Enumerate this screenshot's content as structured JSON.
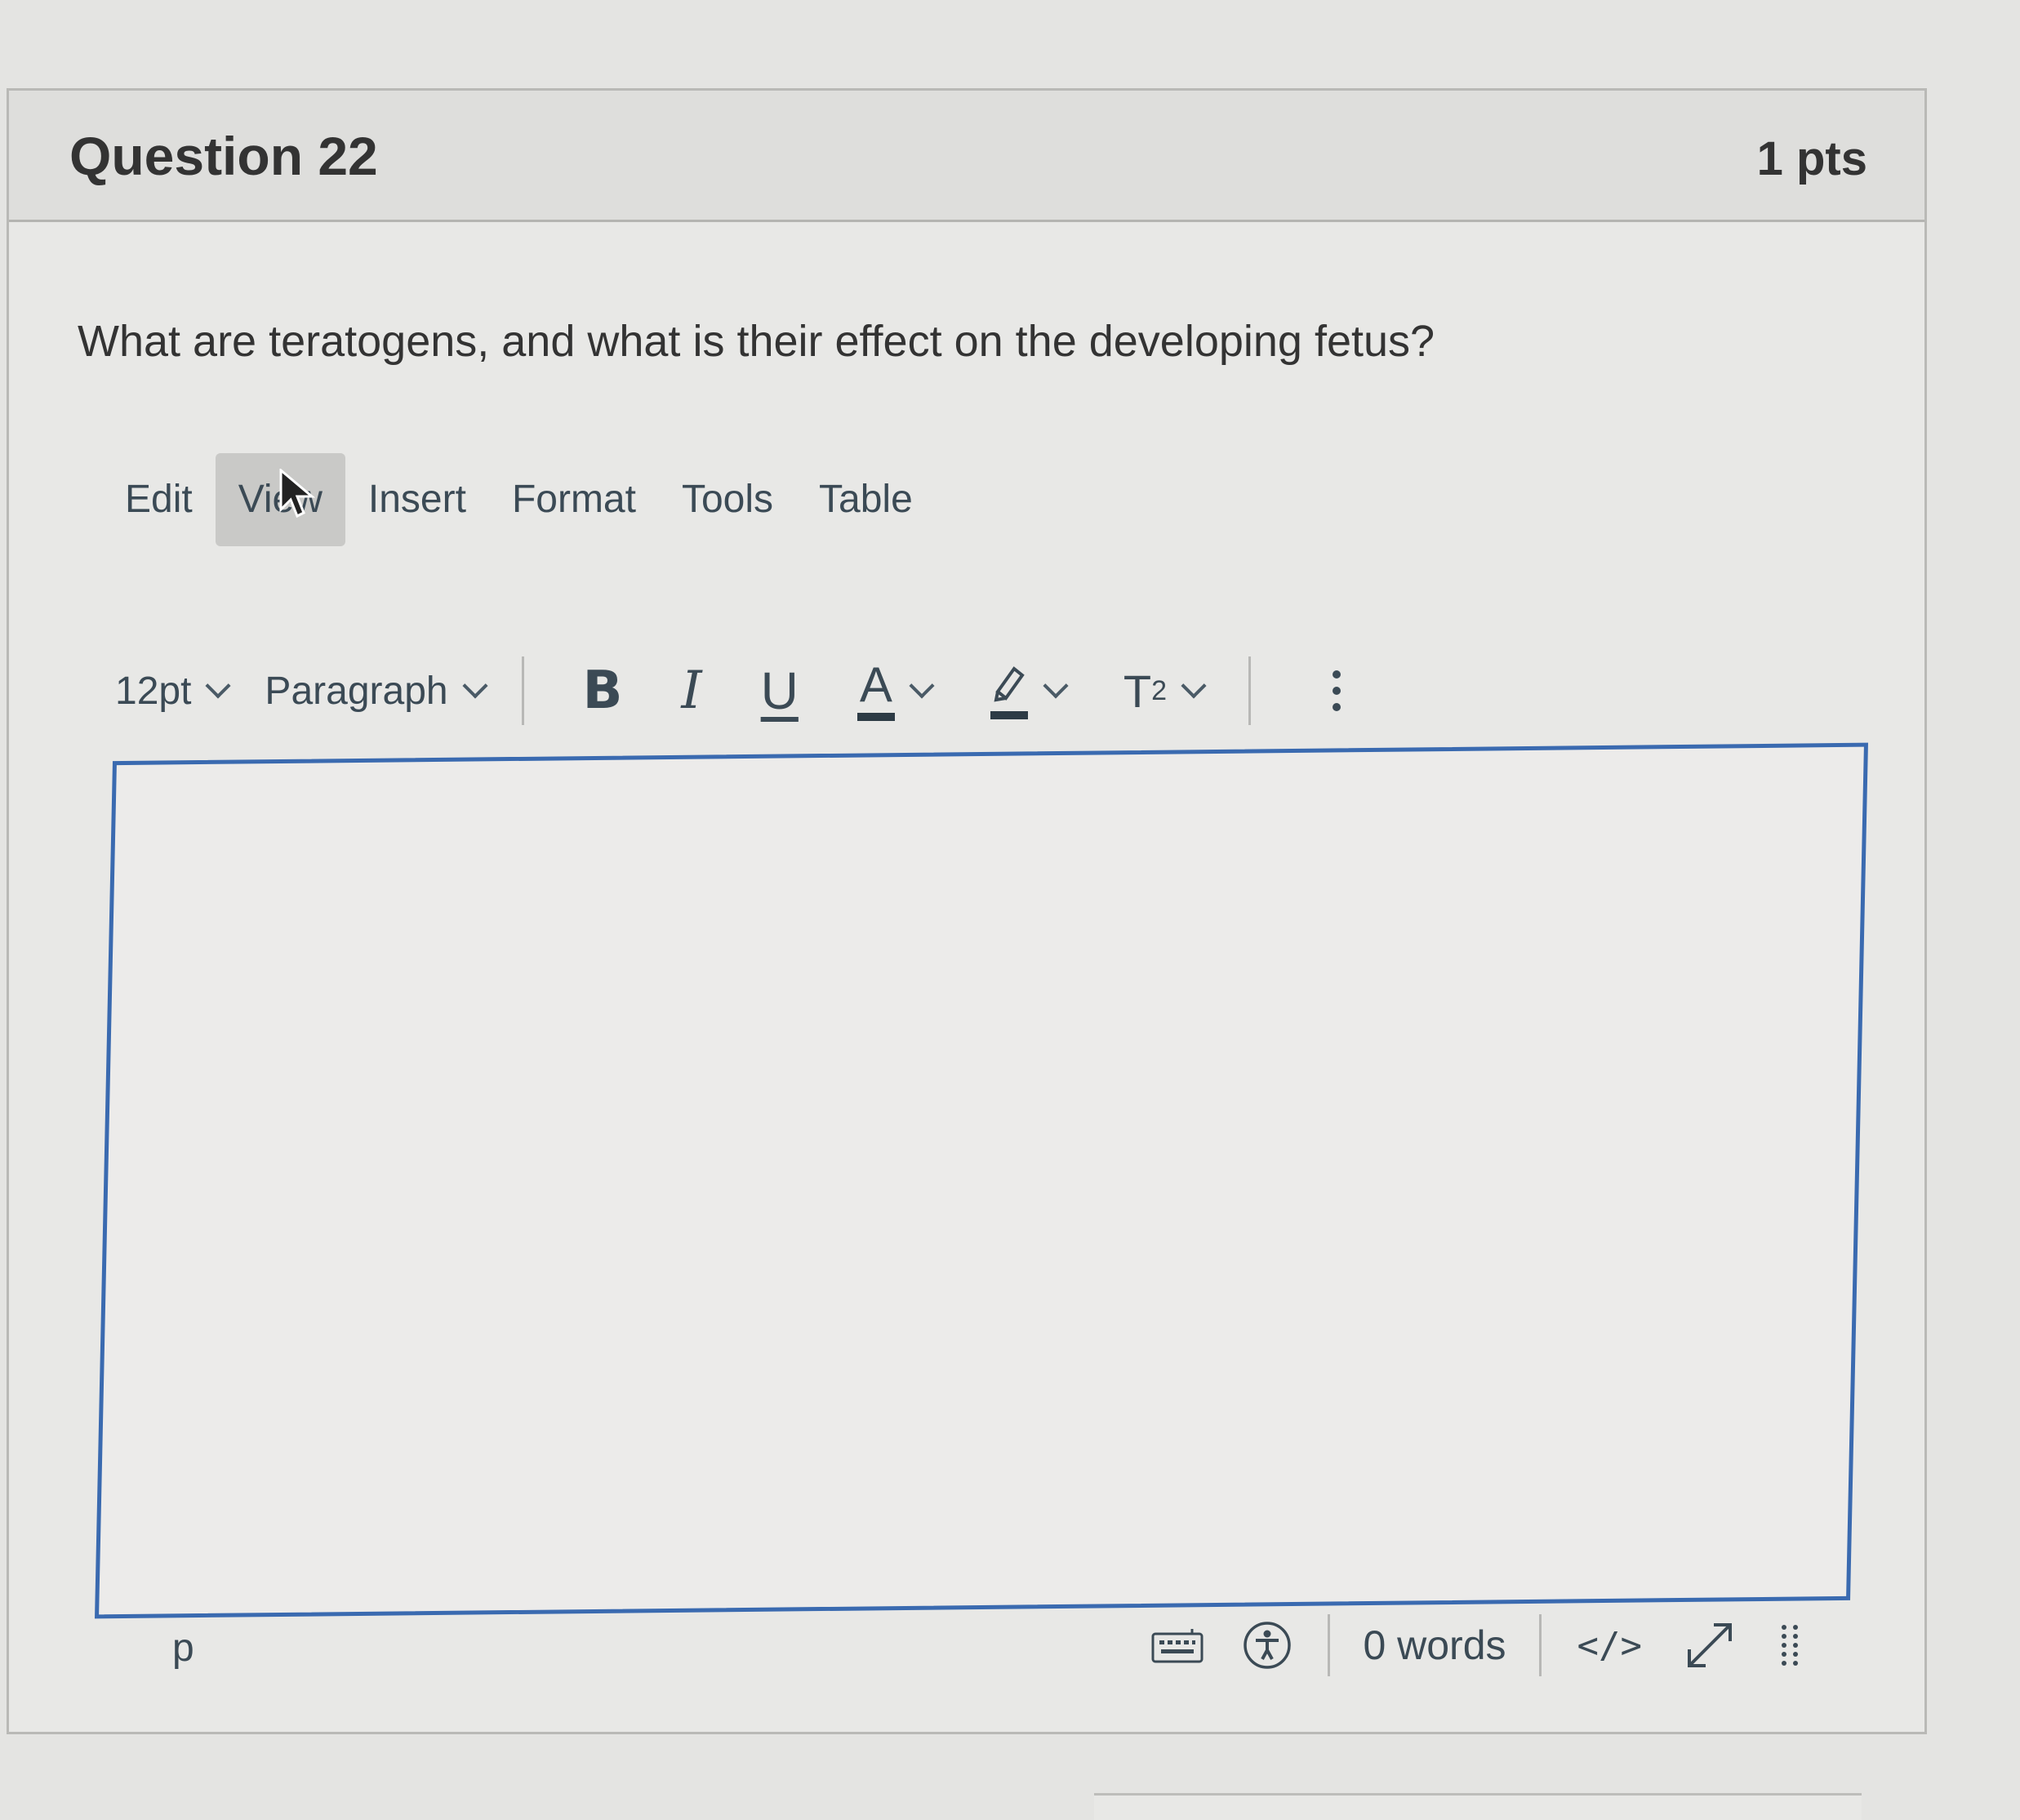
{
  "question": {
    "title": "Question 22",
    "points": "1 pts",
    "text": "What are teratogens, and what is their effect on the developing fetus?"
  },
  "menubar": {
    "items": [
      {
        "label": "Edit"
      },
      {
        "label": "View",
        "active": true
      },
      {
        "label": "Insert"
      },
      {
        "label": "Format"
      },
      {
        "label": "Tools"
      },
      {
        "label": "Table"
      }
    ]
  },
  "toolbar": {
    "font_size": "12pt",
    "block_format": "Paragraph",
    "bold": "B",
    "italic": "I",
    "underline": "U",
    "text_color": "A",
    "superscript_base": "T",
    "superscript_exp": "2",
    "text_color_value": "#2d3b45",
    "highlight_color_value": "#2d3b45",
    "icons": [
      "chevron-down-icon",
      "highlighter-icon",
      "more-vertical-icon"
    ]
  },
  "editor": {
    "content": "",
    "border_color": "#3a6ab0"
  },
  "statusbar": {
    "path": "p",
    "word_count": "0 words",
    "html_toggle": "</>",
    "icons": [
      "keyboard-icon",
      "accessibility-icon",
      "fullscreen-icon",
      "resize-handle-icon"
    ]
  }
}
